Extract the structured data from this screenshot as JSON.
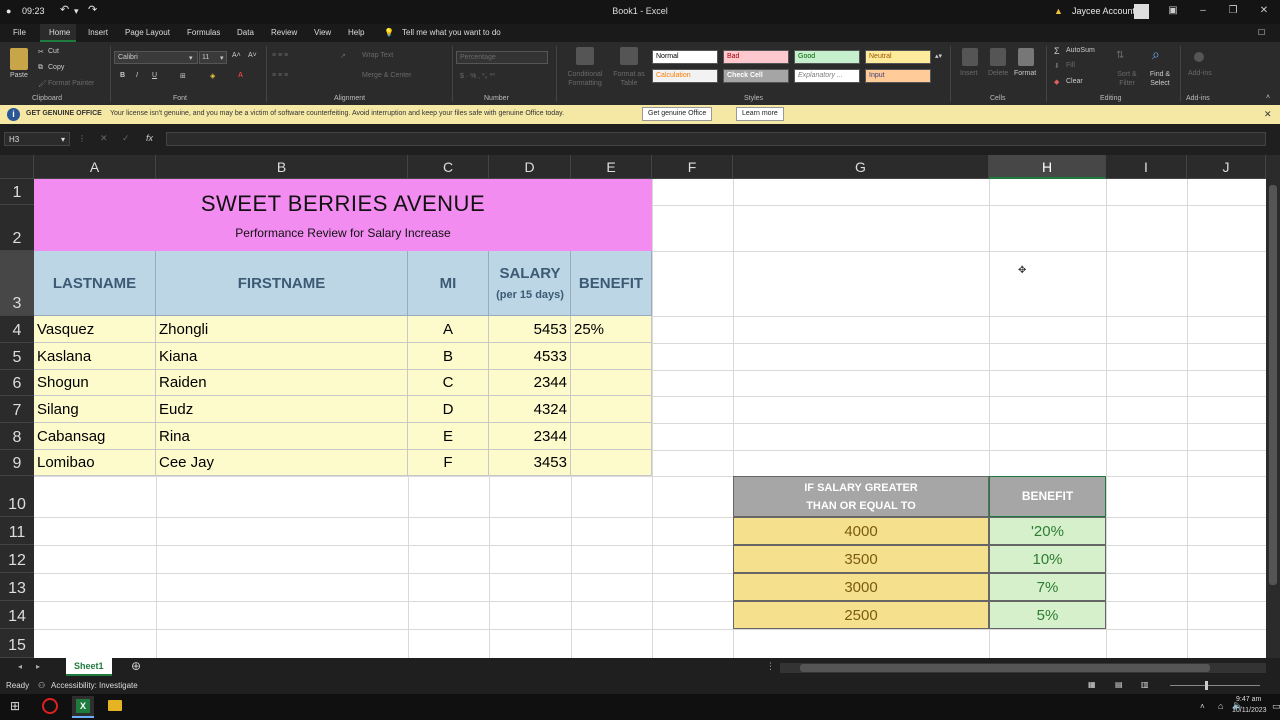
{
  "titlebar": {
    "time": "09:23",
    "title": "Book1 - Excel",
    "account": "Jaycee Account"
  },
  "menu": {
    "tabs": [
      "File",
      "Home",
      "Insert",
      "Page Layout",
      "Formulas",
      "Data",
      "Review",
      "View",
      "Help"
    ],
    "tell_me": "Tell me what you want to do"
  },
  "ribbon": {
    "clipboard": {
      "paste": "Paste",
      "cut": "Cut",
      "copy": "Copy",
      "format_painter": "Format Painter",
      "label": "Clipboard"
    },
    "font": {
      "name": "Calibri",
      "size": "11",
      "label": "Font",
      "bold": "B",
      "italic": "I",
      "underline": "U"
    },
    "alignment": {
      "wrap": "Wrap Text",
      "merge": "Merge & Center",
      "label": "Alignment"
    },
    "number": {
      "format": "Percentage",
      "label": "Number"
    },
    "styles": {
      "conditional": "Conditional Formatting",
      "format_table": "Format as Table",
      "cells": [
        "Normal",
        "Bad",
        "Good",
        "Neutral",
        "Calculation",
        "Check Cell",
        "Explanatory ...",
        "Input"
      ],
      "label": "Styles"
    },
    "cells": {
      "insert": "Insert",
      "delete": "Delete",
      "format": "Format",
      "label": "Cells"
    },
    "editing": {
      "autosum": "AutoSum",
      "fill": "Fill",
      "clear": "Clear",
      "sort": "Sort & Filter",
      "find": "Find & Select",
      "label": "Editing"
    },
    "addins": {
      "add": "Add-ins",
      "label": "Add-ins"
    }
  },
  "license": {
    "heading": "GET GENUINE OFFICE",
    "message": "Your license isn't genuine, and you may be a victim of software counterfeiting. Avoid interruption and keep your files safe with genuine Office today.",
    "btn_genuine": "Get genuine Office",
    "btn_learn": "Learn more"
  },
  "formula_bar": {
    "name_box": "H3",
    "fx": "fx",
    "content": ""
  },
  "columns": [
    "A",
    "B",
    "C",
    "D",
    "E",
    "F",
    "G",
    "H",
    "I",
    "J"
  ],
  "rows": [
    "1",
    "2",
    "3",
    "4",
    "5",
    "6",
    "7",
    "8",
    "9",
    "10",
    "11",
    "12",
    "13",
    "14",
    "15"
  ],
  "sheet": {
    "title": "SWEET BERRIES AVENUE",
    "subtitle": "Performance Review for Salary Increase",
    "headers": {
      "lastname": "LASTNAME",
      "firstname": "FIRSTNAME",
      "mi": "MI",
      "salary": "SALARY",
      "salary_sub": "(per 15 days)",
      "benefit": "BENEFIT"
    },
    "employees": [
      {
        "last": "Vasquez",
        "first": "Zhongli",
        "mi": "A",
        "salary": "5453",
        "benefit": "25%"
      },
      {
        "last": "Kaslana",
        "first": "Kiana",
        "mi": "B",
        "salary": "4533",
        "benefit": ""
      },
      {
        "last": "Shogun",
        "first": "Raiden",
        "mi": "C",
        "salary": "2344",
        "benefit": ""
      },
      {
        "last": "Silang",
        "first": "Eudz",
        "mi": "D",
        "salary": "4324",
        "benefit": ""
      },
      {
        "last": "Cabansag",
        "first": "Rina",
        "mi": "E",
        "salary": "2344",
        "benefit": ""
      },
      {
        "last": "Lomibao",
        "first": "Cee Jay",
        "mi": "F",
        "salary": "3453",
        "benefit": ""
      }
    ],
    "lookup": {
      "header_salary_1": "IF SALARY GREATER",
      "header_salary_2": "THAN OR EQUAL TO",
      "header_benefit": "BENEFIT",
      "rows": [
        {
          "salary": "4000",
          "benefit": "'20%"
        },
        {
          "salary": "3500",
          "benefit": "10%"
        },
        {
          "salary": "3000",
          "benefit": "7%"
        },
        {
          "salary": "2500",
          "benefit": "5%"
        }
      ]
    }
  },
  "sheet_tab": "Sheet1",
  "status": {
    "ready": "Ready",
    "accessibility": "Accessibility: Investigate"
  },
  "taskbar": {
    "time": "9:47 am",
    "date": "10/11/2023"
  },
  "colors": {
    "title_band": "#f28cf0",
    "header_fill": "#bcd6e6",
    "data_fill": "#fdfbcc",
    "excel_green": "#1f7a3d"
  }
}
